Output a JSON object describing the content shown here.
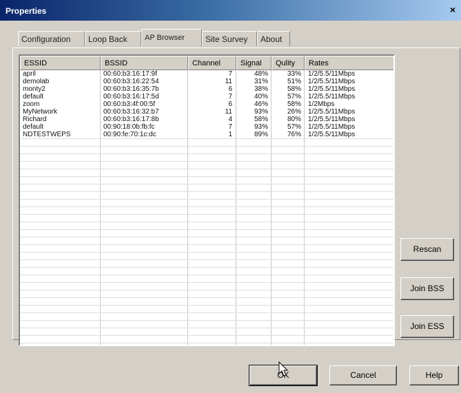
{
  "window": {
    "title": "Properties",
    "close_glyph": "×"
  },
  "tabs": [
    {
      "label": "Configuration"
    },
    {
      "label": "Loop Back"
    },
    {
      "label": "AP Browser"
    },
    {
      "label": "Site Survey"
    },
    {
      "label": "About"
    }
  ],
  "active_tab": "AP Browser",
  "table": {
    "columns": [
      "ESSID",
      "BSSID",
      "Channel",
      "Signal",
      "Qulity",
      "Rates"
    ],
    "rows": [
      [
        "april",
        "00:60:b3:16:17:9f",
        "7",
        "48%",
        "33%",
        "1/2/5.5/11Mbps"
      ],
      [
        "demolab",
        "00:60:b3:16:22:54",
        "11",
        "31%",
        "51%",
        "1/2/5.5/11Mbps"
      ],
      [
        "monty2",
        "00:60:b3:16:35:7b",
        "6",
        "38%",
        "58%",
        "1/2/5.5/11Mbps"
      ],
      [
        "default",
        "00:60:b3:16:17:5d",
        "7",
        "40%",
        "57%",
        "1/2/5.5/11Mbps"
      ],
      [
        "zoom",
        "00:60:b3:4f:00:5f",
        "6",
        "46%",
        "58%",
        "1/2Mbps"
      ],
      [
        "MyNetwork",
        "00:60:b3:16:32:b7",
        "11",
        "93%",
        "26%",
        "1/2/5.5/11Mbps"
      ],
      [
        "Richard",
        "00:60:b3:16:17:8b",
        "4",
        "58%",
        "80%",
        "1/2/5.5/11Mbps"
      ],
      [
        "default",
        "00:90:18:0b:fb:fc",
        "7",
        "93%",
        "57%",
        "1/2/5.5/11Mbps"
      ],
      [
        "NDTESTWEPS",
        "00:90:fe:70:1c:dc",
        "1",
        "89%",
        "76%",
        "1/2/5.5/11Mbps"
      ]
    ]
  },
  "side_buttons": {
    "rescan": "Rescan",
    "join_bss": "Join BSS",
    "join_ess": "Join ESS"
  },
  "footer_buttons": {
    "ok": "OK",
    "cancel": "Cancel",
    "help": "Help"
  }
}
